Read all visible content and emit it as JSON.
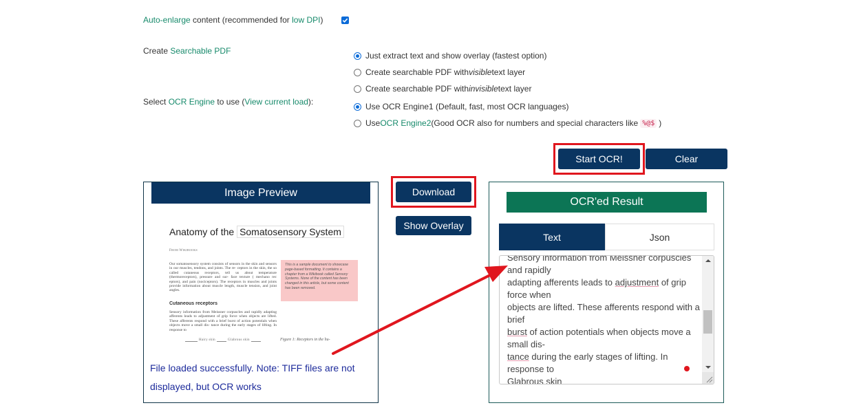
{
  "options": {
    "auto_enlarge": {
      "link1": "Auto-enlarge",
      "text1": " content (recommended for ",
      "link2": "low DPI",
      "text2": ")",
      "checked": true
    },
    "searchable_pdf": {
      "prefix": "Create ",
      "link": "Searchable PDF",
      "choices": [
        {
          "pre": "Just extract text and show overlay (fastest option)",
          "em": "",
          "post": "",
          "checked": true
        },
        {
          "pre": "Create searchable PDF with ",
          "em": "visible",
          "post": " text layer",
          "checked": false
        },
        {
          "pre": "Create searchable PDF with ",
          "em": "invisible",
          "post": " text layer",
          "checked": false
        }
      ]
    },
    "ocr_engine": {
      "prefix": "Select ",
      "link1": "OCR Engine",
      "middle": " to use (",
      "link2": "View current load",
      "suffix": "):",
      "engine1": {
        "label": "Use OCR Engine1 (Default, fast, most OCR languages)",
        "checked": true
      },
      "engine2": {
        "pre": "Use ",
        "link": "OCR Engine2",
        "post": " (Good OCR also for numbers and special characters like ",
        "code": "%@$",
        "end": ")",
        "checked": false
      }
    }
  },
  "buttons": {
    "start_ocr": "Start OCR!",
    "clear": "Clear",
    "download": "Download",
    "show_overlay": "Show Overlay"
  },
  "preview": {
    "header": "Image Preview",
    "doc": {
      "title_plain": "Anatomy of the ",
      "title_boxed": "Somatosensory System",
      "from": "From Wikibooks",
      "para1": "Our somatosensory system consists of sensors in the skin and sensors in our muscles, tendons, and joints. The re- ceptors in the skin, the so called cutaneous receptors, tell us about temperature (thermoreceptors), pressure and sur- face texture ( mechano rec eptors), and pain (nociceptors). The receptors in muscles and joints provide information about muscle length, muscle tension, and joint angles.",
      "note": "This is a sample document to showcase page-based formatting. It contains a chapter from a Wikibook called Sensory Systems. None of the content has been changed in this article, but some content has been removed.",
      "subheading": "Cutaneous receptors",
      "para2": "Sensory information from Meissner corpuscles and rapidly adapting afferents leads to adjustment of grip force when objects are lifted. These afferents respond with a brief burst of action potentials when objects move a small dis- tance during the early stages of lifting. In response to",
      "fig_labels": [
        "Hairy skin",
        "Glabrous skin"
      ],
      "fig_caption": "Figure 1:  Receptors in the hu-"
    },
    "status": "File loaded successfully. Note: TIFF files are not displayed, but OCR works"
  },
  "result": {
    "header": "OCR'ed Result",
    "tabs": [
      {
        "label": "Text",
        "active": true
      },
      {
        "label": "Json",
        "active": false
      }
    ],
    "lines": [
      {
        "text": "Sensory information from Meissner corpuscles",
        "squiggle": ""
      },
      {
        "text": "and rapidly",
        "squiggle": ""
      },
      {
        "pre": "adapting afferents leads to ",
        "squiggle": "adjustment",
        "post": " of grip"
      },
      {
        "text": "force when",
        "squiggle": ""
      },
      {
        "text": "objects are lifted. These afferents respond with a",
        "squiggle": ""
      },
      {
        "text": "brief",
        "squiggle": ""
      },
      {
        "pre": "",
        "squiggle": "burst",
        "post": " of action potentials when objects move a"
      },
      {
        "text": "small dis-",
        "squiggle": ""
      },
      {
        "pre": "",
        "squiggle": "tance",
        "post": " during the early stages of lifting. In"
      },
      {
        "text": "response to",
        "squiggle": ""
      },
      {
        "text": "Glabrous skin",
        "squiggle": ""
      }
    ]
  },
  "annotation_colors": {
    "highlight_box": "#e0161e",
    "arrow": "#e0161e",
    "primary_button": "#0a3561",
    "result_header": "#0c7555",
    "link": "#178a6b"
  }
}
